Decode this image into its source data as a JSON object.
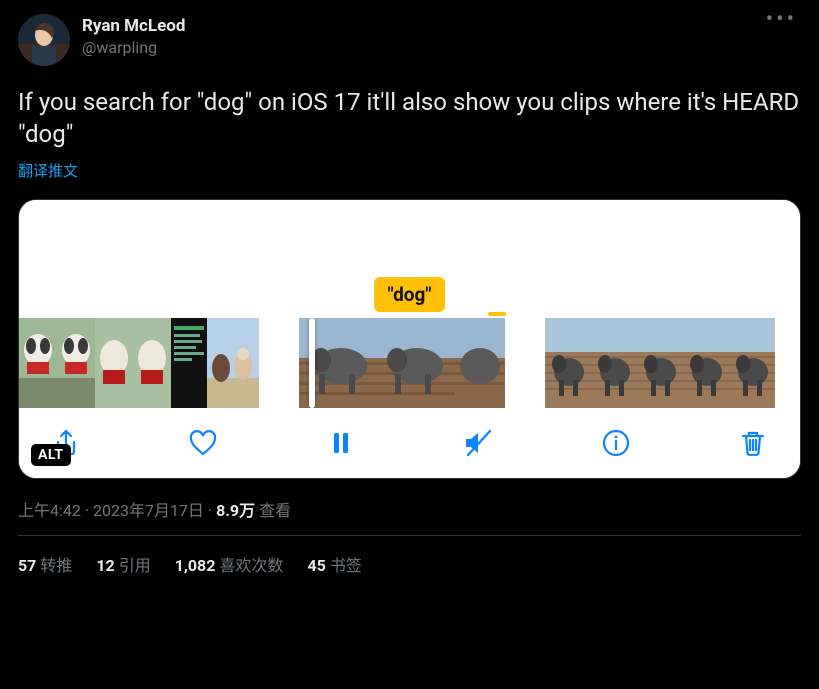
{
  "author": {
    "display_name": "Ryan McLeod",
    "handle": "@warpling"
  },
  "tweet_text": "If you search for \"dog\" on iOS 17 it'll also show you clips where it's HEARD \"dog\"",
  "translate_label": "翻译推文",
  "caption": "\"dog\"",
  "alt_badge": "ALT",
  "toolbar": {
    "share": "share-icon",
    "like": "heart-icon",
    "pause": "pause-icon",
    "mute": "mute-icon",
    "info": "info-icon",
    "trash": "trash-icon"
  },
  "meta": {
    "time": "上午4:42",
    "date": "2023年7月17日",
    "views_number": "8.9万",
    "views_label": "查看"
  },
  "stats": {
    "retweets_count": "57",
    "retweets_label": "转推",
    "quotes_count": "12",
    "quotes_label": "引用",
    "likes_count": "1,082",
    "likes_label": "喜欢次数",
    "bookmarks_count": "45",
    "bookmarks_label": "书签"
  }
}
